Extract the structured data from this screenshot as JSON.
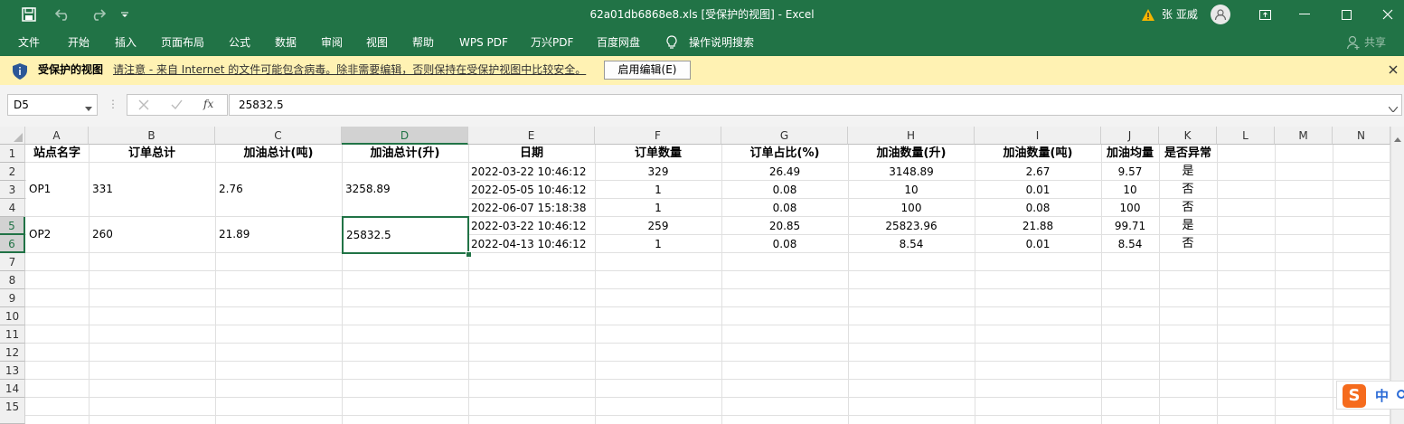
{
  "window": {
    "title": "62a01db6868e8.xls  [受保护的视图]  -  Excel",
    "user_name": "张 亚威",
    "share_label": "共享"
  },
  "ribbon": {
    "tabs": [
      "文件",
      "开始",
      "插入",
      "页面布局",
      "公式",
      "数据",
      "审阅",
      "视图",
      "帮助",
      "WPS PDF",
      "万兴PDF",
      "百度网盘",
      "操作说明搜索"
    ]
  },
  "protected_bar": {
    "label": "受保护的视图",
    "message": "请注意 - 来自 Internet 的文件可能包含病毒。除非需要编辑，否则保持在受保护视图中比较安全。",
    "enable_button": "启用编辑(E)"
  },
  "formula_bar": {
    "name_box": "D5",
    "fx": "fx",
    "value": "25832.5"
  },
  "sheet": {
    "columns": [
      "A",
      "B",
      "C",
      "D",
      "E",
      "F",
      "G",
      "H",
      "I",
      "J",
      "K",
      "L",
      "M",
      "N"
    ],
    "rows": [
      "1",
      "2",
      "3",
      "4",
      "5",
      "6",
      "7",
      "8",
      "9",
      "10",
      "11",
      "12",
      "13",
      "14",
      "15"
    ],
    "headers": [
      "站点名字",
      "订单总计",
      "加油总计(吨)",
      "加油总计(升)",
      "日期",
      "订单数量",
      "订单占比(%)",
      "加油数量(升)",
      "加油数量(吨)",
      "加油均量",
      "是否异常"
    ],
    "merged": [
      {
        "site": "OP1",
        "orders": "331",
        "tons": "2.76",
        "liters": "3258.89"
      },
      {
        "site": "OP2",
        "orders": "260",
        "tons": "21.89",
        "liters": "25832.5"
      }
    ],
    "detail_rows": [
      [
        "2022-03-22 10:46:12",
        "329",
        "26.49",
        "3148.89",
        "2.67",
        "9.57",
        "是"
      ],
      [
        "2022-05-05 10:46:12",
        "1",
        "0.08",
        "10",
        "0.01",
        "10",
        "否"
      ],
      [
        "2022-06-07 15:18:38",
        "1",
        "0.08",
        "100",
        "0.08",
        "100",
        "否"
      ],
      [
        "2022-03-22 10:46:12",
        "259",
        "20.85",
        "25823.96",
        "21.88",
        "99.71",
        "是"
      ],
      [
        "2022-04-13 10:46:12",
        "1",
        "0.08",
        "8.54",
        "0.01",
        "8.54",
        "否"
      ]
    ]
  },
  "ime": {
    "label": "中"
  },
  "colors": {
    "excel_green": "#217346",
    "protected_yellow": "#fff2b3"
  }
}
